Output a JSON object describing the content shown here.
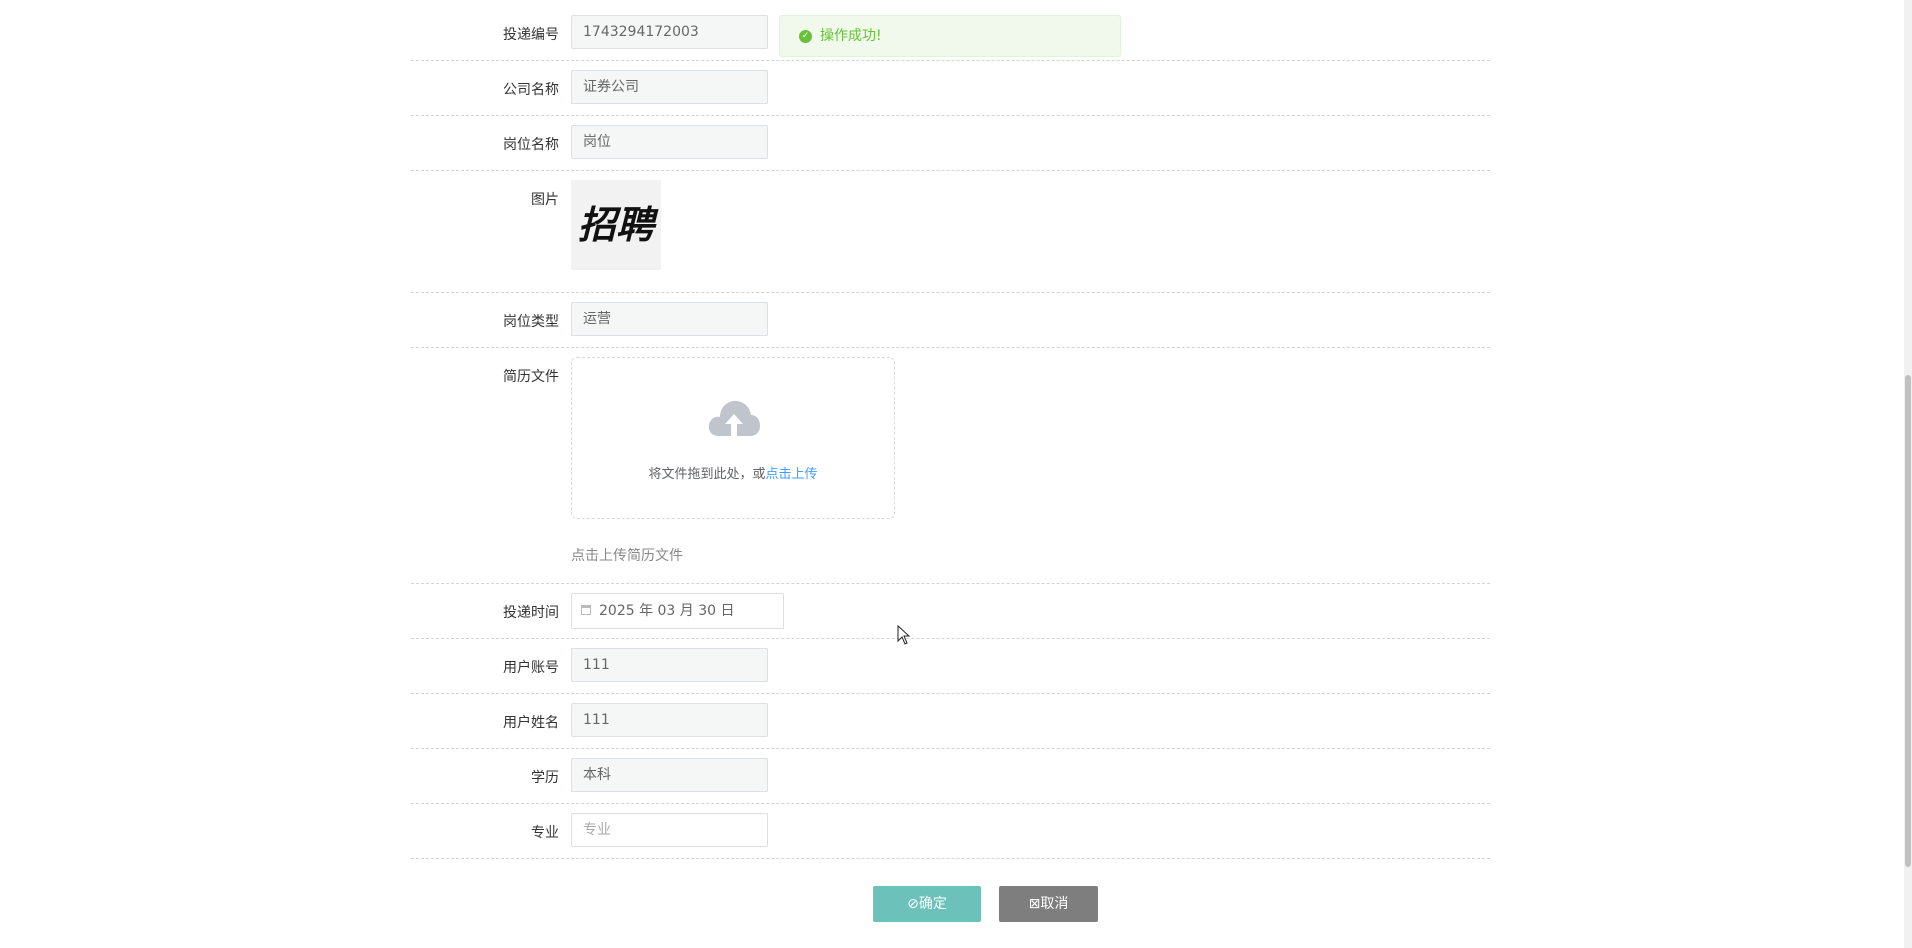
{
  "toast": {
    "text": "操作成功!"
  },
  "fields": {
    "delivery_no": {
      "label": "投递编号",
      "value": "1743294172003"
    },
    "company": {
      "label": "公司名称",
      "value": "证券公司"
    },
    "position": {
      "label": "岗位名称",
      "value": "岗位"
    },
    "image": {
      "label": "图片",
      "image_text": "招聘"
    },
    "position_type": {
      "label": "岗位类型",
      "value": "运营"
    },
    "resume": {
      "label": "简历文件",
      "upload_text": "将文件拖到此处，或",
      "upload_link": "点击上传",
      "tip": "点击上传简历文件"
    },
    "delivery_time": {
      "label": "投递时间",
      "value": "2025 年 03 月 30 日"
    },
    "user_account": {
      "label": "用户账号",
      "value": "111"
    },
    "user_name": {
      "label": "用户姓名",
      "value": "111"
    },
    "education": {
      "label": "学历",
      "value": "本科"
    },
    "major": {
      "label": "专业",
      "placeholder": "专业"
    }
  },
  "buttons": {
    "confirm": "确定",
    "cancel": "取消"
  },
  "colors": {
    "confirm_bg": "#6cc2bb",
    "cancel_bg": "#7e7e7e",
    "success": "#67c23a",
    "link": "#409eff"
  }
}
